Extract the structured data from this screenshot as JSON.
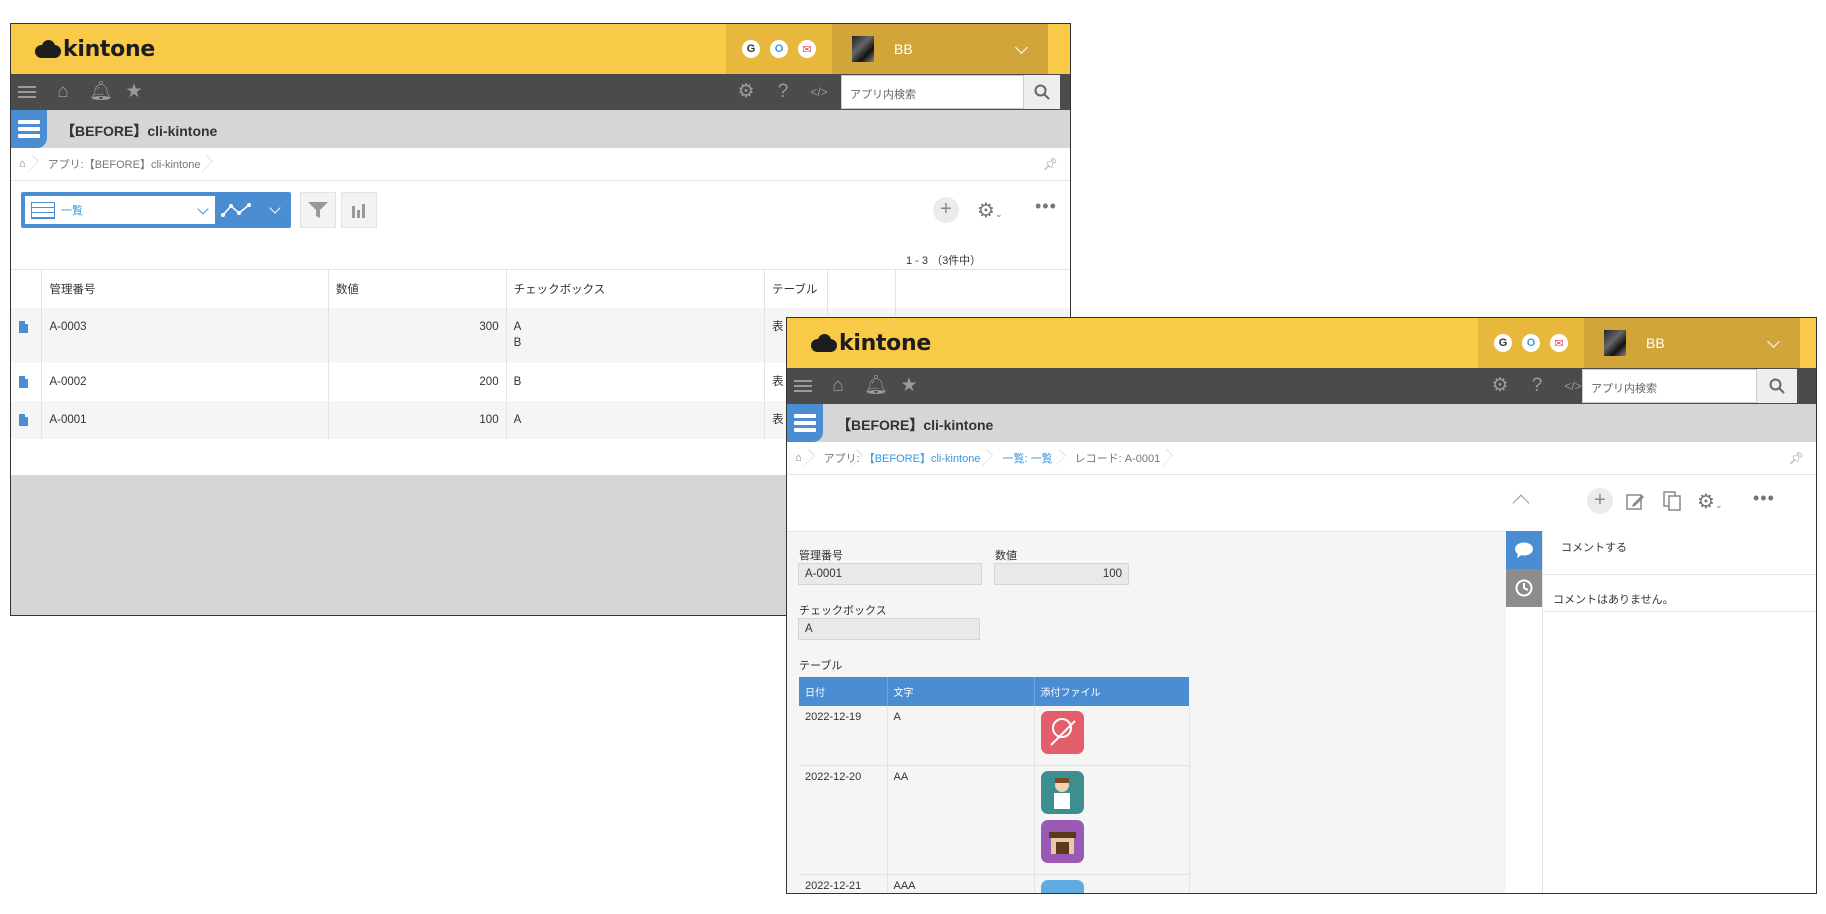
{
  "brand": "kintone",
  "user_name": "BB",
  "services": [
    "G",
    "O",
    "✉"
  ],
  "search_placeholder": "アプリ内検索",
  "app_title": "【BEFORE】cli-kintone",
  "list_window": {
    "breadcrumb": [
      "アプリ:【BEFORE】cli-kintone"
    ],
    "view_name": "一覧",
    "count_text": "1 - 3 （3件中）",
    "columns": [
      "管理番号",
      "数値",
      "チェックボックス",
      "テーブル"
    ],
    "rows": [
      {
        "id": "A-0003",
        "num": "300",
        "check": "A\nB",
        "table": "表"
      },
      {
        "id": "A-0002",
        "num": "200",
        "check": "B",
        "table": "表"
      },
      {
        "id": "A-0001",
        "num": "100",
        "check": "A",
        "table": "表"
      }
    ]
  },
  "detail_window": {
    "breadcrumb": [
      "アプリ:",
      "【BEFORE】cli-kintone",
      "一覧: 一覧",
      "レコード: A-0001"
    ],
    "fields": {
      "id_label": "管理番号",
      "id_value": "A-0001",
      "num_label": "数値",
      "num_value": "100",
      "check_label": "チェックボックス",
      "check_value": "A",
      "table_label": "テーブル"
    },
    "subtable": {
      "headers": [
        "日付",
        "文字",
        "添付ファイル"
      ],
      "rows": [
        {
          "date": "2022-12-19",
          "text": "A",
          "files": [
            "diagram-image"
          ]
        },
        {
          "date": "2022-12-20",
          "text": "AA",
          "files": [
            "person-image",
            "shop-image"
          ]
        },
        {
          "date": "2022-12-21",
          "text": "AAA",
          "files": [
            "palette-image"
          ]
        }
      ]
    },
    "comment_prompt": "コメントする",
    "comment_empty": "コメントはありません。"
  },
  "colors": {
    "header": "#f8ca47",
    "navbar": "#4b4b4b",
    "accent": "#4b8dd2"
  }
}
